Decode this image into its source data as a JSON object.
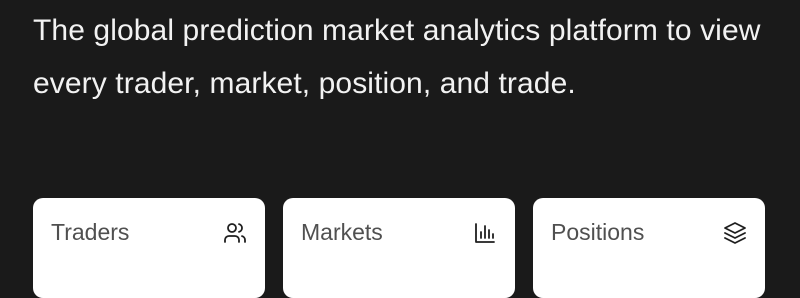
{
  "hero": {
    "text": "The global prediction market analytics platform to view every trader, market, position, and trade."
  },
  "cards": [
    {
      "label": "Traders",
      "icon": "users-icon"
    },
    {
      "label": "Markets",
      "icon": "bar-chart-icon"
    },
    {
      "label": "Positions",
      "icon": "layers-icon"
    }
  ],
  "colors": {
    "background": "#1a1a1a",
    "hero_text": "#f2f2f2",
    "card_background": "#ffffff",
    "card_label": "#505050",
    "icon_stroke": "#1f1f1f"
  }
}
